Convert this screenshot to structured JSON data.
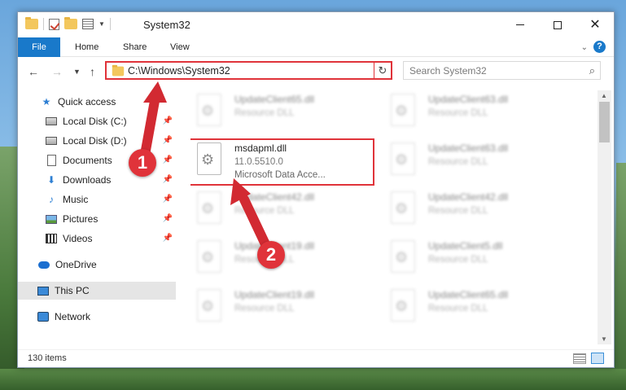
{
  "window": {
    "title": "System32"
  },
  "ribbon": {
    "tabs": [
      "File",
      "Home",
      "Share",
      "View"
    ],
    "help_label": "?"
  },
  "navigation": {
    "address_path": "C:\\Windows\\System32",
    "search_placeholder": "Search System32"
  },
  "sidebar": {
    "items": [
      {
        "label": "Quick access"
      },
      {
        "label": "Local Disk (C:)"
      },
      {
        "label": "Local Disk (D:)"
      },
      {
        "label": "Documents"
      },
      {
        "label": "Downloads"
      },
      {
        "label": "Music"
      },
      {
        "label": "Pictures"
      },
      {
        "label": "Videos"
      },
      {
        "label": "OneDrive"
      },
      {
        "label": "This PC"
      },
      {
        "label": "Network"
      }
    ]
  },
  "files": [
    {
      "name": "UpdateClient65.dll",
      "type": "Resource DLL"
    },
    {
      "name": "UpdateClient63.dll",
      "type": "Resource DLL"
    },
    {
      "name": "msdapml.dll",
      "version": "11.0.5510.0",
      "description": "Microsoft Data Acce..."
    },
    {
      "name": "UpdateClient63.dll",
      "type": "Resource DLL"
    },
    {
      "name": "UpdateClient42.dll",
      "type": "Resource DLL"
    },
    {
      "name": "UpdateClient42.dll",
      "type": "Resource DLL"
    },
    {
      "name": "UpdateClient19.dll",
      "type": "Resource DLL"
    },
    {
      "name": "UpdateClient5.dll",
      "type": "Resource DLL"
    },
    {
      "name": "UpdateClient19.dll",
      "type": "Resource DLL"
    },
    {
      "name": "UpdateClient65.dll",
      "type": "Resource DLL"
    }
  ],
  "status": {
    "item_count": "130 items"
  },
  "annotations": {
    "step1": "1",
    "step2": "2"
  },
  "colors": {
    "accent": "#1979ca",
    "highlight": "#e0333a"
  }
}
